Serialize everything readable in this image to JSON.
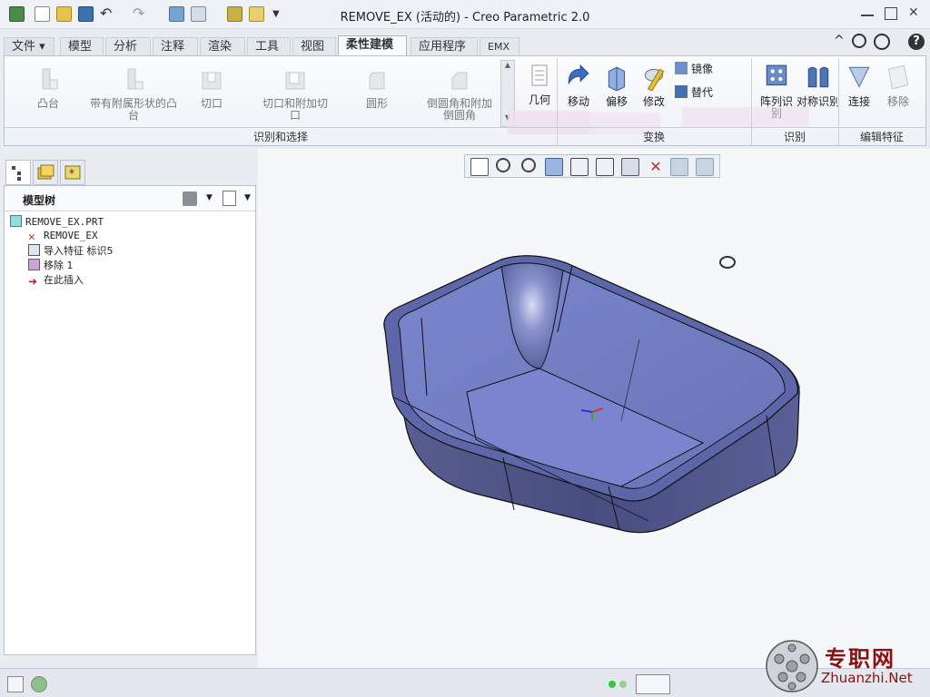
{
  "title": "REMOVE_EX (活动的) - Creo Parametric 2.0",
  "tabs": [
    "文件 ▾",
    "模型",
    "分析",
    "注释",
    "渲染",
    "工具",
    "视图",
    "柔性建模",
    "应用程序",
    "EMX"
  ],
  "ribbon": {
    "group1_buttons": [
      "凸台",
      "带有附属形状的凸台",
      "切口",
      "切口和附加切口",
      "圆形",
      "倒圆角和附加倒圆角"
    ],
    "group1_label": "识别和选择",
    "geom_button": "几何",
    "transform_buttons": [
      "移动",
      "偏移",
      "修改"
    ],
    "small_buttons": [
      "镜像",
      "替代"
    ],
    "transform_label": "变换",
    "recognize_buttons": [
      "阵列识别",
      "对称识别"
    ],
    "recognize_label": "识别",
    "edit_buttons": [
      "连接",
      "移除"
    ],
    "edit_label": "编辑特征"
  },
  "tree": {
    "title": "模型树",
    "items": [
      "REMOVE_EX.PRT",
      "REMOVE_EX",
      "导入特征 标识5",
      "移除 1",
      "在此插入"
    ]
  },
  "watermark": {
    "cn": "专职网",
    "en": "Zhuanzhi.Net"
  }
}
